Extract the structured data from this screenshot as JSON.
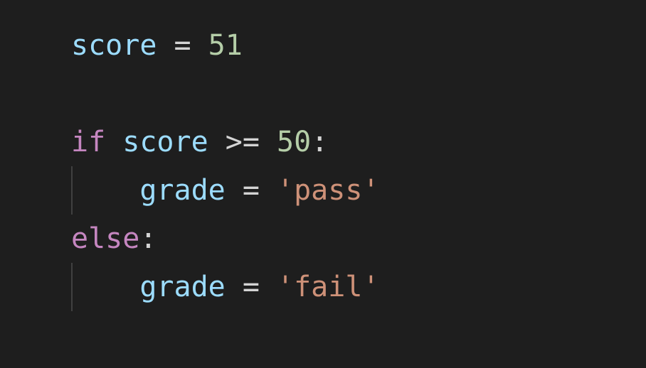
{
  "code": {
    "line1": {
      "var": "score",
      "assign": " = ",
      "value": "51"
    },
    "line3": {
      "keyword": "if",
      "space1": " ",
      "var": "score",
      "space2": " ",
      "op": ">=",
      "space3": " ",
      "value": "50",
      "colon": ":"
    },
    "line4": {
      "indent": "    ",
      "var": "grade",
      "assign": " = ",
      "string": "'pass'"
    },
    "line5": {
      "keyword": "else",
      "colon": ":"
    },
    "line6": {
      "indent": "    ",
      "var": "grade",
      "assign": " = ",
      "string": "'fail'"
    }
  }
}
